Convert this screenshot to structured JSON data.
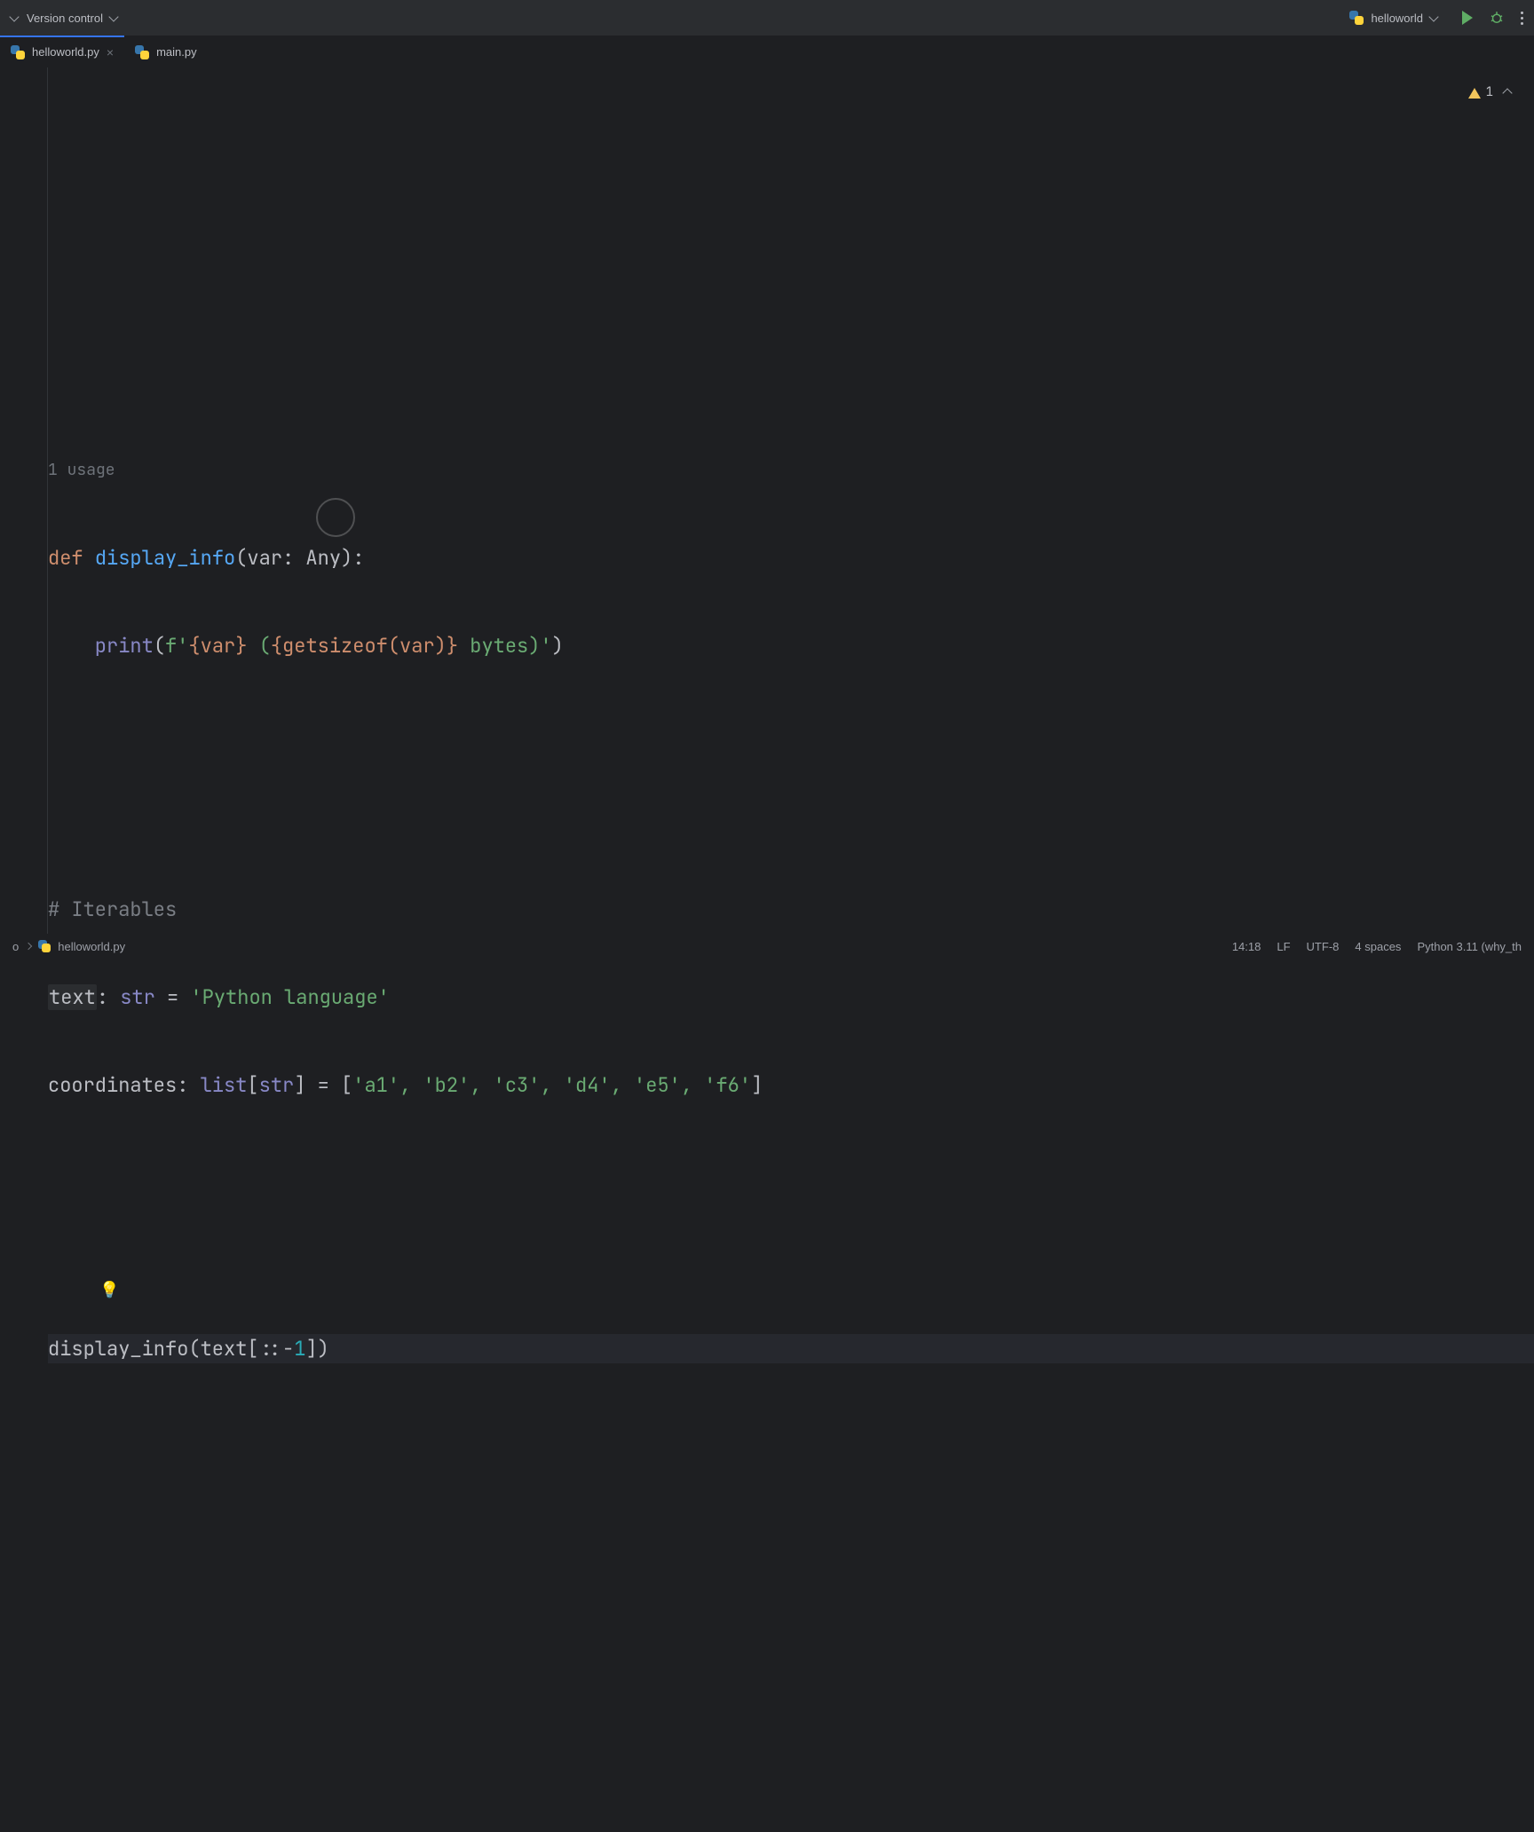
{
  "topbar": {
    "vc_label": "Version control",
    "run_config": "helloworld"
  },
  "tabs": [
    {
      "label": "helloworld.py",
      "active": true
    },
    {
      "label": "main.py",
      "active": false
    }
  ],
  "inspection": {
    "warning_count": "1"
  },
  "code": {
    "usage_hint": "1 usage",
    "l_def": "def ",
    "l_fn": "display_info",
    "l_sig": "(var: Any):",
    "l_print_a": "    print",
    "l_print_b": "(",
    "l_fstr_a": "f'",
    "l_fstr_b": "{var}",
    "l_fstr_c": " (",
    "l_fstr_d": "{getsizeof(var)}",
    "l_fstr_e": " bytes)",
    "l_fstr_f": "'",
    "l_print_c": ")",
    "comment": "# Iterables",
    "l_text_a": "text",
    "l_text_b": ": ",
    "l_text_c": "str",
    "l_text_d": " = ",
    "l_text_e": "'Python language'",
    "l_coord_a": "coordinates: ",
    "l_coord_b": "list",
    "l_coord_c": "[",
    "l_coord_d": "str",
    "l_coord_e": "] = [",
    "l_coord_items": "'a1', 'b2', 'c3', 'd4', 'e5', 'f6'",
    "l_coord_f": "]",
    "call_a": "display_info(text[",
    "call_b": "::-",
    "call_c": "1",
    "call_d": "])"
  },
  "statusbar": {
    "breadcrumb_repo": "o",
    "breadcrumb_file": "helloworld.py",
    "cursor": "14:18",
    "line_ending": "LF",
    "encoding": "UTF-8",
    "indent": "4 spaces",
    "interpreter": "Python 3.11 (why_th"
  }
}
